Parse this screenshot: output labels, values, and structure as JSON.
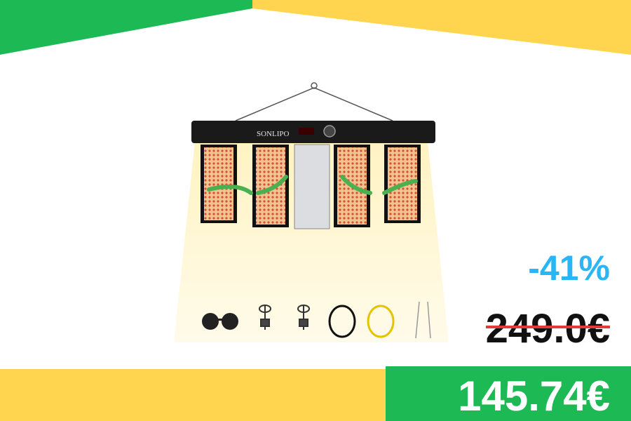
{
  "product": {
    "brand": "SONLIPO",
    "accessories": [
      "sunglasses-icon",
      "rope-hanger-icon",
      "rope-hanger-icon",
      "power-cable-icon",
      "daisy-chain-cable-icon",
      "hanging-wire-icon"
    ]
  },
  "pricing": {
    "discount": "-41%",
    "old_price": "249.0€",
    "new_price": "145.74€"
  },
  "colors": {
    "green": "#1db954",
    "yellow": "#ffd54f",
    "discount_blue": "#29b6f6",
    "strike_red": "#e53935"
  }
}
